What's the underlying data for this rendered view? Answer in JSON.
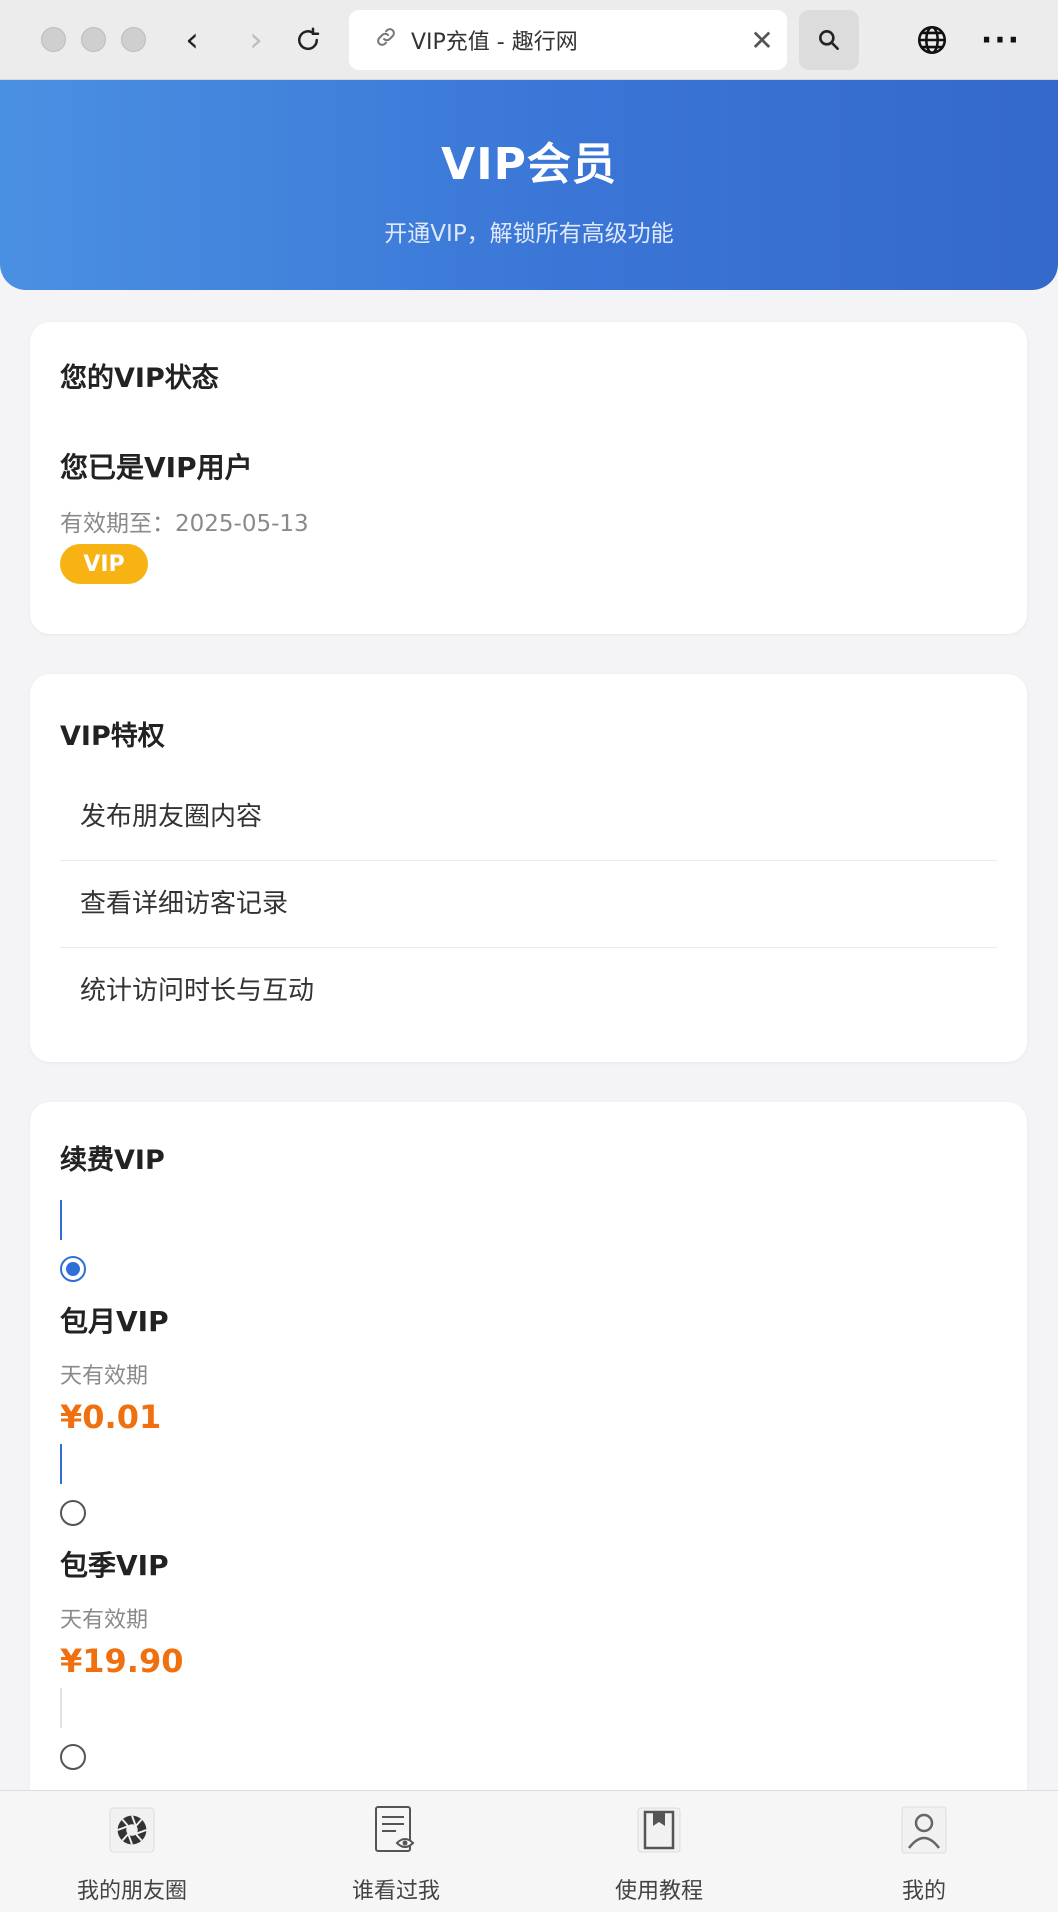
{
  "browser": {
    "tab_title": "VIP充值 - 趣行网",
    "back_glyph": "‹",
    "forward_glyph": "›",
    "close_glyph": "✕",
    "more_glyph": "···"
  },
  "hero": {
    "title": "VIP会员",
    "subtitle": "开通VIP，解锁所有高级功能"
  },
  "status": {
    "title": "您的VIP状态",
    "main": "您已是VIP用户",
    "expiry": "有效期至：2025-05-13",
    "badge": "VIP"
  },
  "privileges": {
    "title": "VIP特权",
    "items": [
      "发布朋友圈内容",
      "查看详细访客记录",
      "统计访问时长与互动"
    ]
  },
  "renew": {
    "title": "续费VIP",
    "plans": [
      {
        "name": "包月VIP",
        "desc": "天有效期",
        "price": "¥0.01",
        "selected": true
      },
      {
        "name": "包季VIP",
        "desc": "天有效期",
        "price": "¥19.90",
        "selected": false
      },
      {
        "name": "",
        "desc": "",
        "price": "",
        "selected": false
      }
    ]
  },
  "tabbar": {
    "items": [
      {
        "label": "我的朋友圈",
        "icon": "aperture-icon"
      },
      {
        "label": "谁看过我",
        "icon": "document-eye-icon"
      },
      {
        "label": "使用教程",
        "icon": "book-icon"
      },
      {
        "label": "我的",
        "icon": "user-icon"
      }
    ]
  },
  "colors": {
    "hero_start": "#4a90e2",
    "hero_end": "#3469c9",
    "accent": "#2f6fd6",
    "badge": "#f7b314",
    "price": "#f0700f"
  }
}
